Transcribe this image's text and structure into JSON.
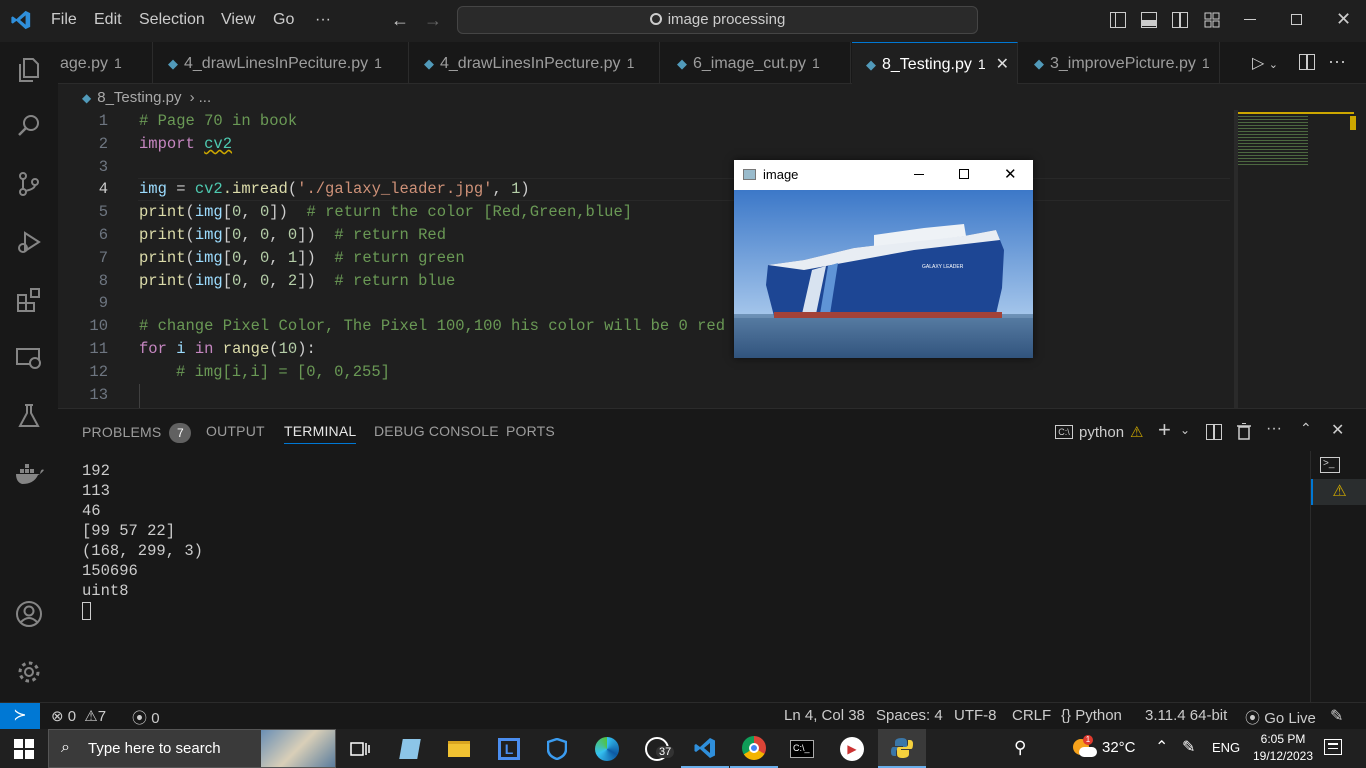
{
  "menu": [
    "File",
    "Edit",
    "Selection",
    "View",
    "Go",
    "···"
  ],
  "search": {
    "text": "image processing"
  },
  "tabs": [
    {
      "label": "age.py",
      "badge": "1"
    },
    {
      "label": "4_drawLinesInPeciture.py",
      "badge": "1"
    },
    {
      "label": "4_drawLinesInPecture.py",
      "badge": "1"
    },
    {
      "label": "6_image_cut.py",
      "badge": "1"
    },
    {
      "label": "8_Testing.py",
      "badge": "1"
    },
    {
      "label": "3_improvePicture.py",
      "badge": "1"
    }
  ],
  "breadcrumb": {
    "file": "8_Testing.py",
    "sep": "›",
    "more": "..."
  },
  "line_numbers": [
    "1",
    "2",
    "3",
    "4",
    "5",
    "6",
    "7",
    "8",
    "9",
    "10",
    "11",
    "12",
    "13"
  ],
  "code": {
    "l1": "# Page 70 in book",
    "l2_kw": "import",
    "l2_mod": "cv2",
    "l4_var": "img",
    "l4_eq": " = ",
    "l4_mod": "cv2",
    "l4_fn": ".imread",
    "l4_str": "'./galaxy_leader.jpg'",
    "l4_num": "1",
    "l5_cmt": "# return the color [Red,Green,blue]",
    "l6_cmt": "# return Red",
    "l7_cmt": "# return green",
    "l8_cmt": "# return blue",
    "l10": "# change Pixel Color, The Pixel 100,100 his color will be 0 red",
    "l11_for": "for",
    "l11_i": "i",
    "l11_in": "in",
    "l11_range": "range",
    "l11_num": "10",
    "l12": "# img[i,i] = [0, 0,255]"
  },
  "image_window": {
    "title": "image",
    "ship_name": "GALAXY LEADER"
  },
  "panel": {
    "tabs": [
      "PROBLEMS",
      "OUTPUT",
      "TERMINAL",
      "DEBUG CONSOLE",
      "PORTS"
    ],
    "problems_count": "7",
    "terminal_name": "python",
    "output": [
      "192",
      "113",
      "46",
      "[99 57 22]",
      "(168, 299, 3)",
      "150696",
      "uint8"
    ]
  },
  "status": {
    "errors": "0",
    "warnings": "7",
    "ports": "0",
    "position": "Ln 4, Col 38",
    "spaces": "Spaces: 4",
    "encoding": "UTF-8",
    "eol": "CRLF",
    "language": "Python",
    "interpreter": "3.11.4 64-bit",
    "golive": "Go Live"
  },
  "taskbar": {
    "search_placeholder": "Type here to search",
    "whatsapp_badge": "37",
    "temperature": "32°C",
    "lang": "ENG",
    "time": "6:05 PM",
    "date": "19/12/2023"
  },
  "colors": {
    "accent": "#0078d4",
    "editor_bg": "#1f1f1f",
    "keyword": "#c586c0",
    "string": "#ce9178",
    "comment": "#6a9955"
  }
}
